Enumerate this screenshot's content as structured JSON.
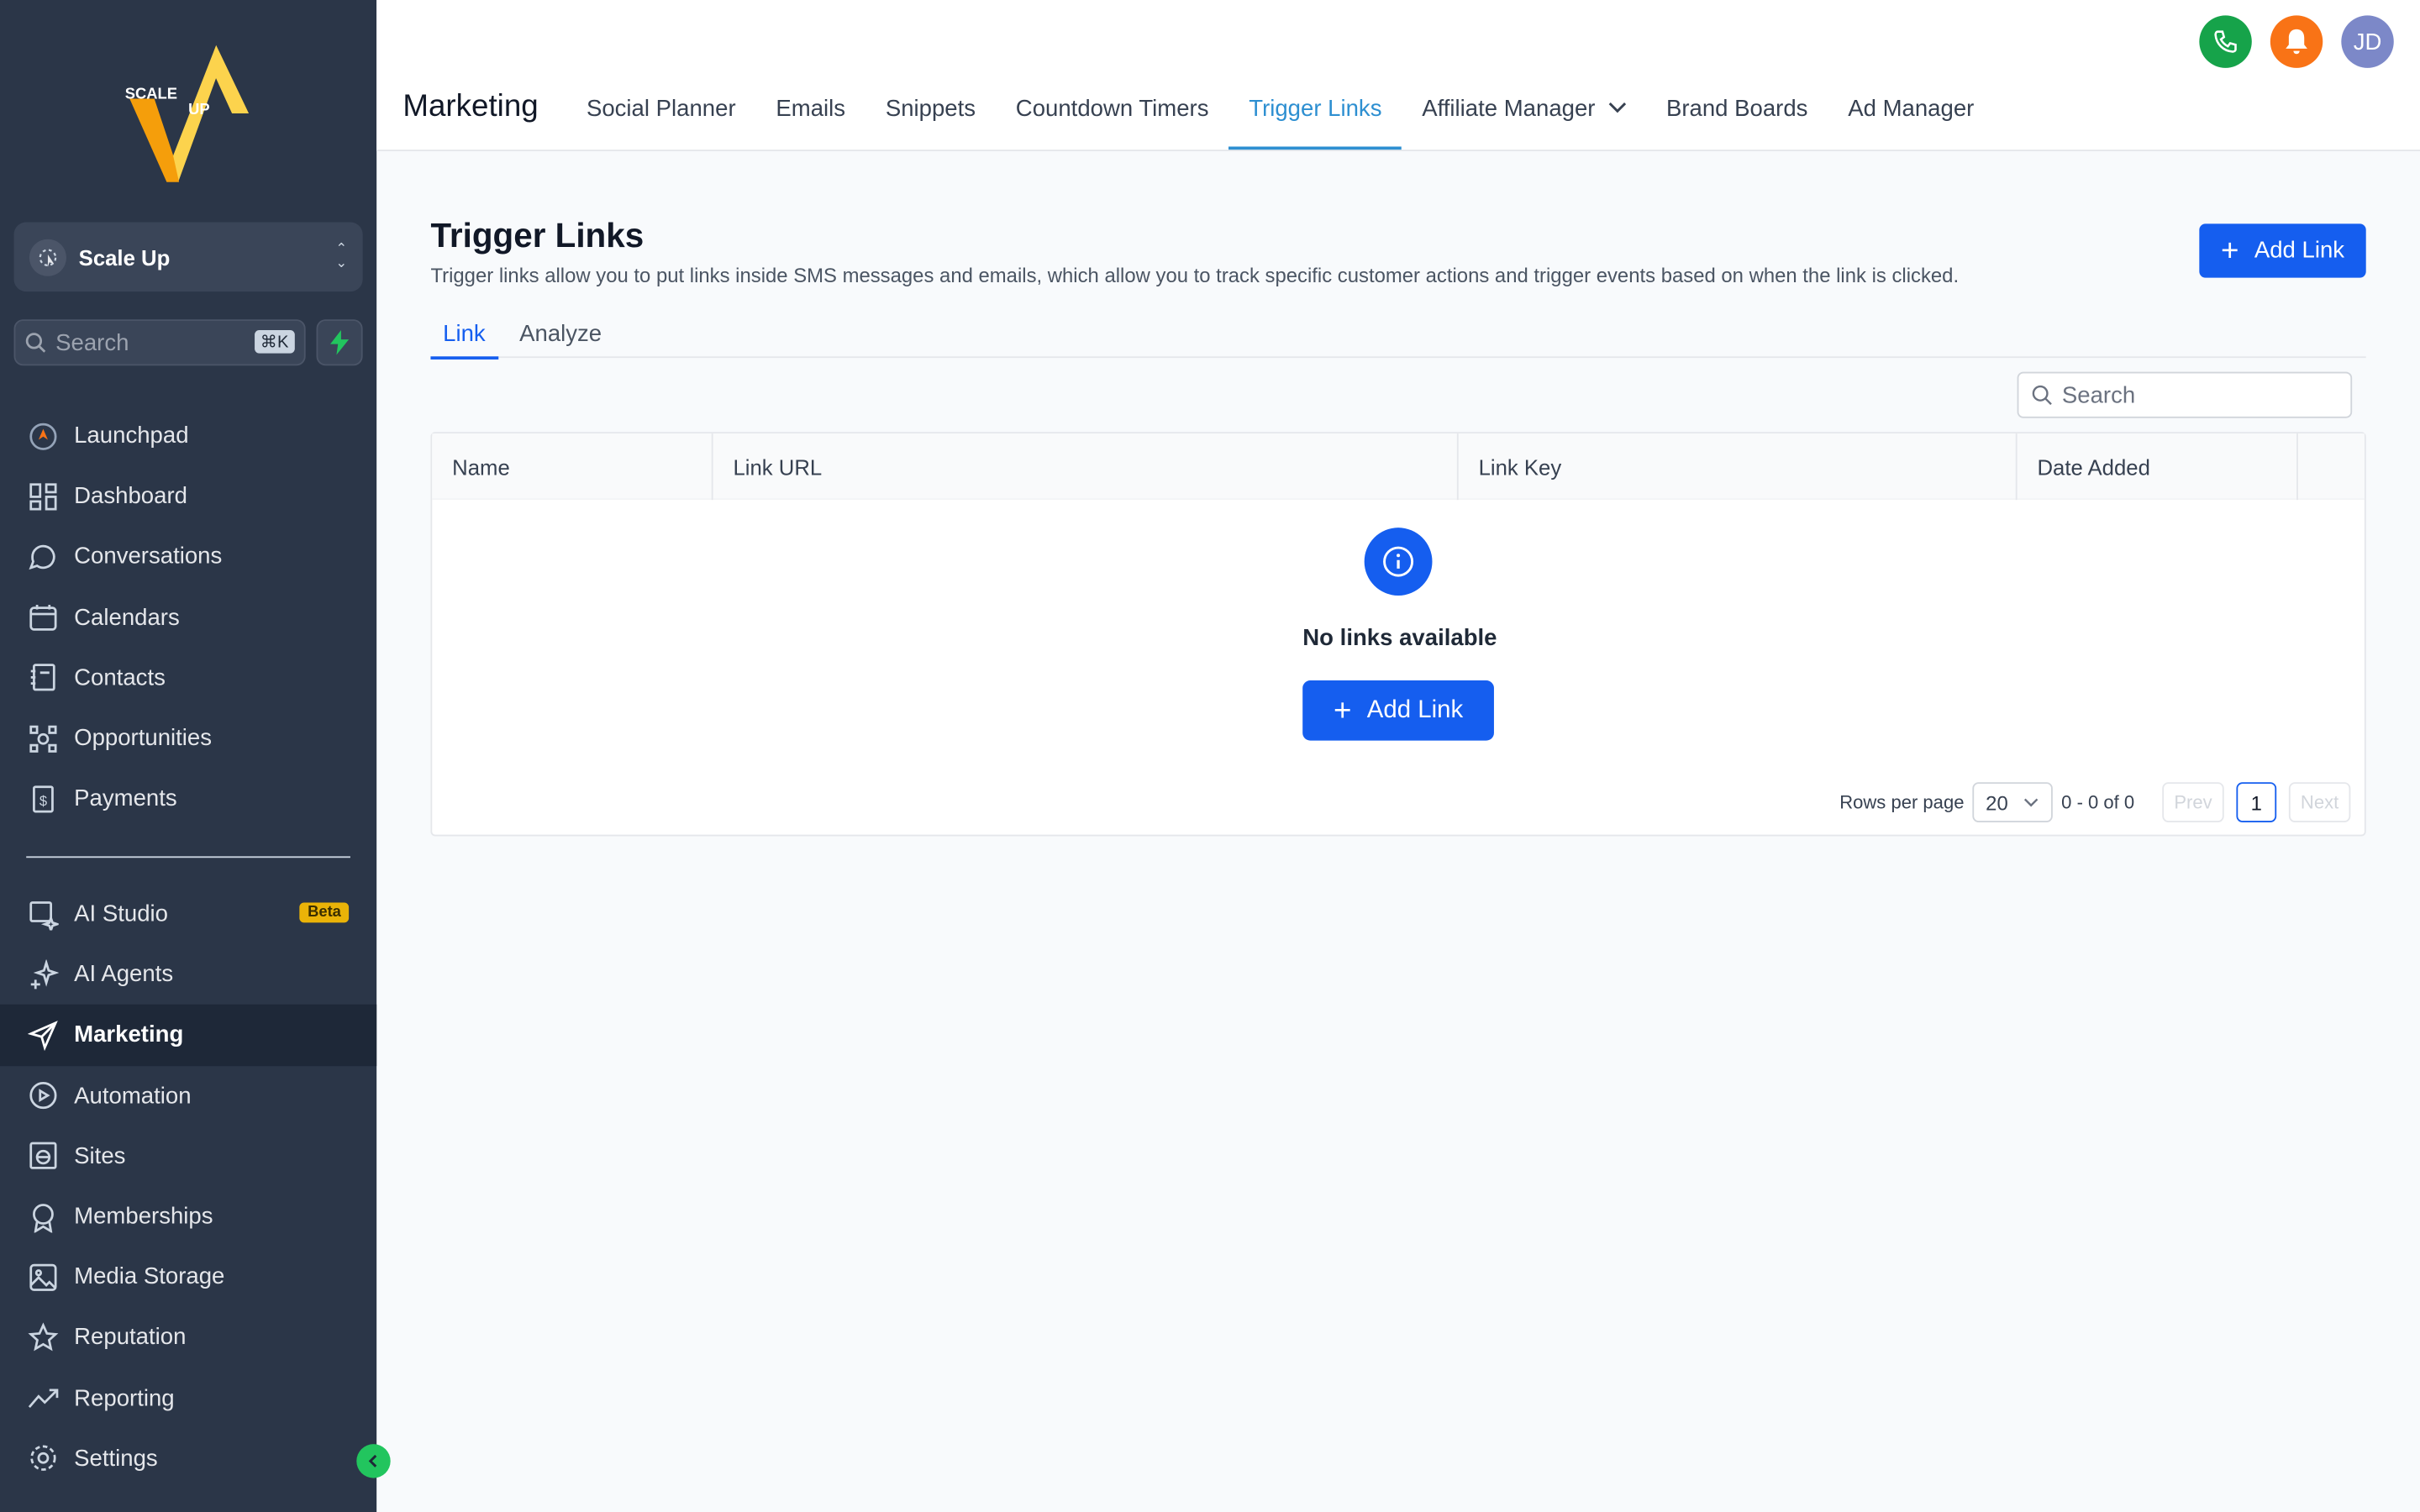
{
  "sidebar": {
    "logo_text": "SCALE UP",
    "account_name": "Scale Up",
    "search_placeholder": "Search",
    "search_shortcut": "⌘K",
    "nav_primary": [
      {
        "label": "Launchpad",
        "icon": "rocket-icon"
      },
      {
        "label": "Dashboard",
        "icon": "grid-icon"
      },
      {
        "label": "Conversations",
        "icon": "chat-icon"
      },
      {
        "label": "Calendars",
        "icon": "calendar-icon"
      },
      {
        "label": "Contacts",
        "icon": "contacts-icon"
      },
      {
        "label": "Opportunities",
        "icon": "opportunities-icon"
      },
      {
        "label": "Payments",
        "icon": "payments-icon"
      }
    ],
    "nav_secondary": [
      {
        "label": "AI Studio",
        "icon": "ai-studio-icon",
        "badge": "Beta"
      },
      {
        "label": "AI Agents",
        "icon": "sparkle-icon"
      },
      {
        "label": "Marketing",
        "icon": "send-icon",
        "active": true
      },
      {
        "label": "Automation",
        "icon": "automation-icon"
      },
      {
        "label": "Sites",
        "icon": "globe-icon"
      },
      {
        "label": "Memberships",
        "icon": "badge-icon"
      },
      {
        "label": "Media Storage",
        "icon": "image-icon"
      },
      {
        "label": "Reputation",
        "icon": "star-icon"
      },
      {
        "label": "Reporting",
        "icon": "trend-icon"
      },
      {
        "label": "Settings",
        "icon": "gear-icon"
      }
    ]
  },
  "header": {
    "section_title": "Marketing",
    "tabs": [
      {
        "label": "Social Planner"
      },
      {
        "label": "Emails"
      },
      {
        "label": "Snippets"
      },
      {
        "label": "Countdown Timers"
      },
      {
        "label": "Trigger Links",
        "active": true
      },
      {
        "label": "Affiliate Manager",
        "dropdown": true
      },
      {
        "label": "Brand Boards"
      },
      {
        "label": "Ad Manager"
      }
    ],
    "avatar_initials": "JD"
  },
  "page": {
    "title": "Trigger Links",
    "description": "Trigger links allow you to put links inside SMS messages and emails, which allow you to track specific customer actions and trigger events based on when the link is clicked.",
    "add_button_label": "Add Link",
    "subtabs": [
      {
        "label": "Link",
        "active": true
      },
      {
        "label": "Analyze"
      }
    ],
    "search_placeholder": "Search",
    "table": {
      "columns": [
        "Name",
        "Link URL",
        "Link Key",
        "Date Added"
      ],
      "empty_text": "No links available",
      "empty_button_label": "Add Link"
    },
    "pagination": {
      "rows_per_page_label": "Rows per page",
      "rows_per_page": "20",
      "range": "0 - 0 of 0",
      "prev": "Prev",
      "page": "1",
      "next": "Next"
    }
  },
  "colors": {
    "sidebar_bg": "#2b3648",
    "primary": "#155eef",
    "active_tab": "#2d8fd1",
    "phone": "#16a34a",
    "bell": "#f97316",
    "beta": "#eab308"
  }
}
